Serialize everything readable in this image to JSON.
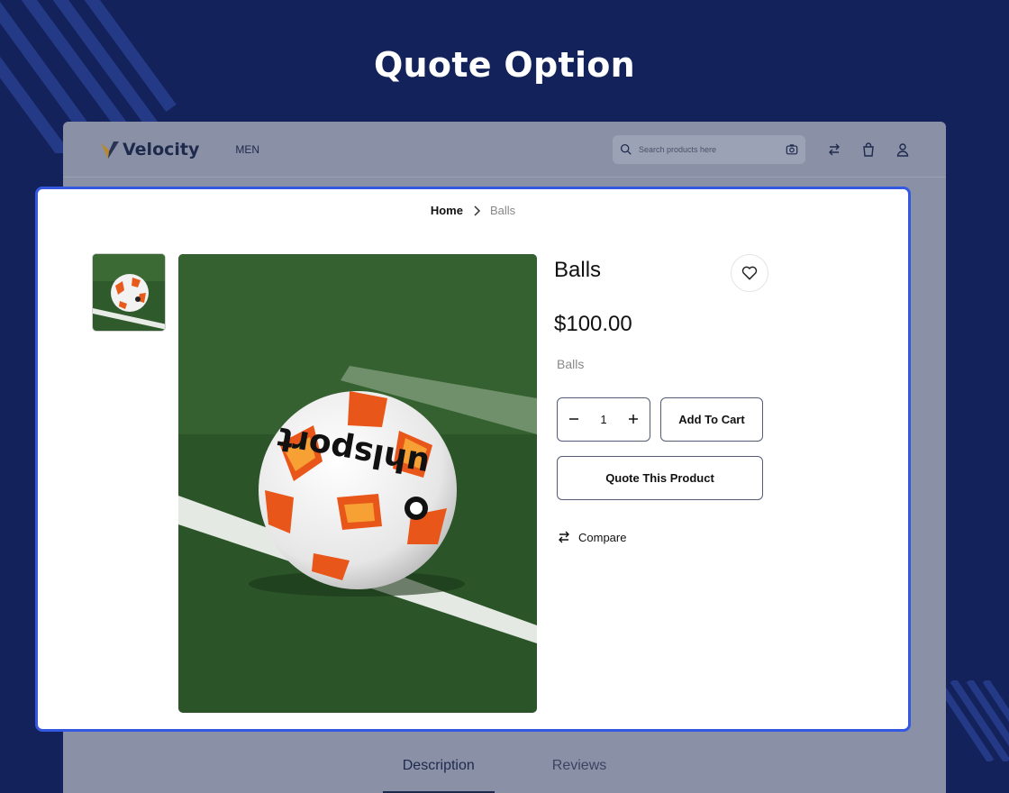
{
  "hero": {
    "title": "Quote Option"
  },
  "header": {
    "logo_text": "Velocity",
    "nav_men": "MEN",
    "search_placeholder": "Search products here",
    "icons": [
      "search-icon",
      "camera-icon",
      "compare-icon",
      "bag-icon",
      "user-icon"
    ]
  },
  "breadcrumb": {
    "home": "Home",
    "current": "Balls"
  },
  "product": {
    "title": "Balls",
    "price": "$100.00",
    "category": "Balls",
    "quantity": "1",
    "add_to_cart": "Add To Cart",
    "quote": "Quote This Product",
    "compare": "Compare"
  },
  "tabs": [
    {
      "label": "Description"
    },
    {
      "label": "Reviews"
    }
  ],
  "colors": {
    "background": "#13225a",
    "highlight_border": "#3459e0",
    "overlay": "#8a90a6"
  }
}
